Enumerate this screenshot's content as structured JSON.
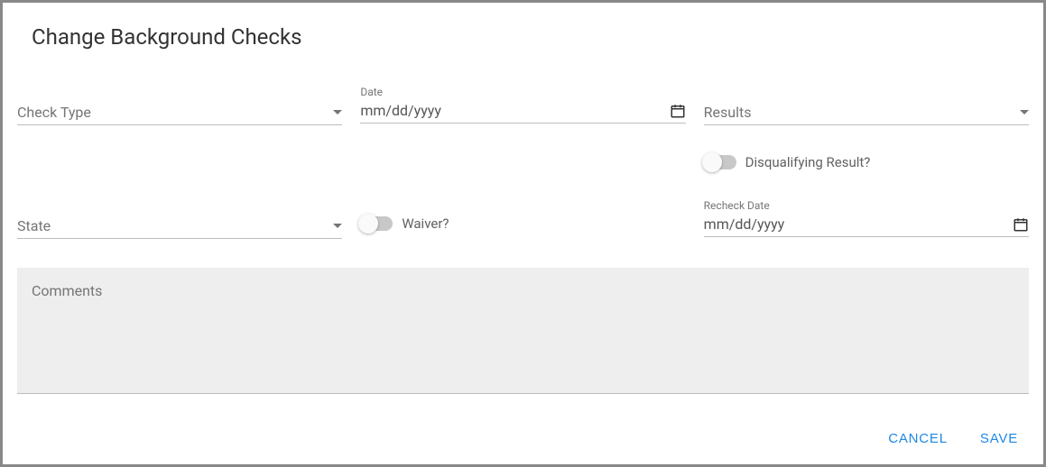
{
  "dialog": {
    "title": "Change Background Checks"
  },
  "fields": {
    "check_type": {
      "label": "Check Type"
    },
    "date": {
      "label": "Date",
      "placeholder": "mm/dd/yyyy"
    },
    "results": {
      "label": "Results"
    },
    "disqualifying": {
      "label": "Disqualifying Result?"
    },
    "state": {
      "label": "State"
    },
    "waiver": {
      "label": "Waiver?"
    },
    "recheck_date": {
      "label": "Recheck Date",
      "placeholder": "mm/dd/yyyy"
    },
    "comments": {
      "label": "Comments"
    }
  },
  "actions": {
    "cancel": "CANCEL",
    "save": "SAVE"
  }
}
